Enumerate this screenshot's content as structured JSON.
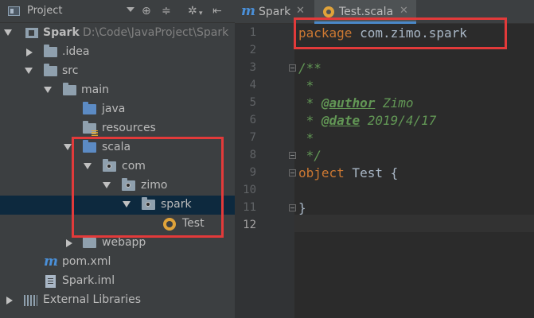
{
  "project_panel": {
    "title": "Project",
    "toolbar_icons": [
      "target-icon",
      "collapse-icon",
      "settings-icon",
      "hide-icon"
    ],
    "tree": [
      {
        "label": "Spark",
        "path": "D:\\Code\\JavaProject\\Spark",
        "type": "module",
        "expanded": true
      },
      {
        "label": ".idea",
        "type": "folder",
        "expanded": false
      },
      {
        "label": "src",
        "type": "folder",
        "expanded": true
      },
      {
        "label": "main",
        "type": "folder",
        "expanded": true
      },
      {
        "label": "java",
        "type": "source-folder"
      },
      {
        "label": "resources",
        "type": "resources-folder"
      },
      {
        "label": "scala",
        "type": "source-folder",
        "expanded": true
      },
      {
        "label": "com",
        "type": "package",
        "expanded": true
      },
      {
        "label": "zimo",
        "type": "package",
        "expanded": true
      },
      {
        "label": "spark",
        "type": "package",
        "expanded": true,
        "selected": true
      },
      {
        "label": "Test",
        "type": "scala-object"
      },
      {
        "label": "webapp",
        "type": "folder",
        "expanded": false
      },
      {
        "label": "pom.xml",
        "type": "maven-file"
      },
      {
        "label": "Spark.iml",
        "type": "iml-file"
      },
      {
        "label": "External Libraries",
        "type": "libraries",
        "expanded": false
      }
    ]
  },
  "editor": {
    "tabs": [
      {
        "label": "Spark",
        "icon": "maven-icon",
        "active": false
      },
      {
        "label": "Test.scala",
        "icon": "scala-object-icon",
        "active": true
      }
    ],
    "line_numbers": [
      "1",
      "2",
      "3",
      "4",
      "5",
      "6",
      "7",
      "8",
      "9",
      "10",
      "11",
      "12"
    ],
    "current_line": "12",
    "code": {
      "l1_kw": "package",
      "l1_rest": " com.zimo.spark",
      "l3": "/**",
      "l4": " *",
      "l5_star": " * ",
      "l5_tag": "@author",
      "l5_val": " Zimo",
      "l6_star": " * ",
      "l6_tag": "@date",
      "l6_val": " 2019/4/17",
      "l7": " *",
      "l8": " */",
      "l9_kw": "object",
      "l9_rest": " Test {",
      "l11": "}"
    }
  },
  "colors": {
    "highlight_box": "#e23a3a",
    "keyword": "#cc7832",
    "doc_comment": "#629755",
    "selection": "#0d293e"
  }
}
